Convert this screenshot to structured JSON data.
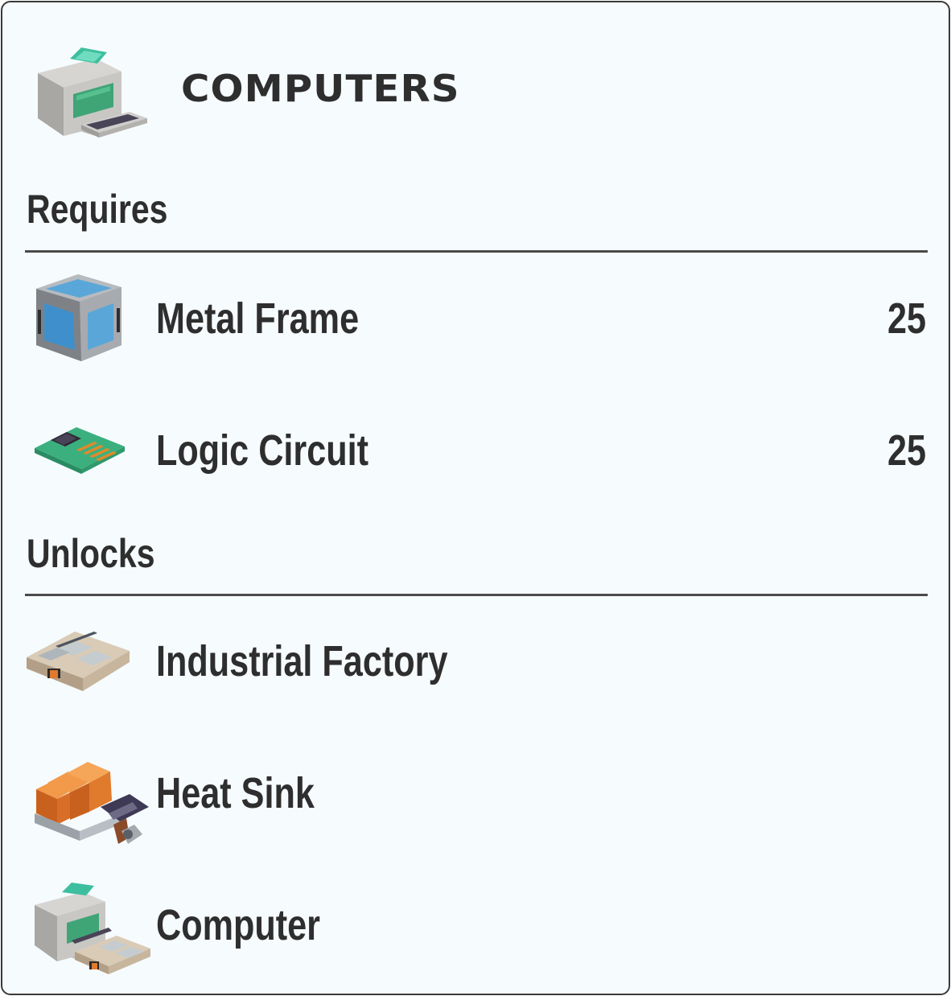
{
  "header": {
    "title": "COMPUTERS",
    "icon": "computer-icon"
  },
  "requires": {
    "label": "Requires",
    "items": [
      {
        "label": "Metal Frame",
        "count": "25",
        "icon": "metal-frame-icon"
      },
      {
        "label": "Logic Circuit",
        "count": "25",
        "icon": "logic-circuit-icon"
      }
    ]
  },
  "unlocks": {
    "label": "Unlocks",
    "items": [
      {
        "label": "Industrial Factory",
        "icon": "industrial-factory-icon"
      },
      {
        "label": "Heat Sink",
        "icon": "heat-sink-icon"
      },
      {
        "label": "Computer",
        "icon": "computer-icon"
      }
    ]
  },
  "colors": {
    "panel_background": "#f6fbfe",
    "border": "#3a3a3a",
    "text": "#2e2e2e",
    "computer_screen": "#3fa577",
    "frame_glass": "#5aa6d8",
    "circuit_board": "#3bb07e",
    "heat_sink": "#e07a2c"
  }
}
